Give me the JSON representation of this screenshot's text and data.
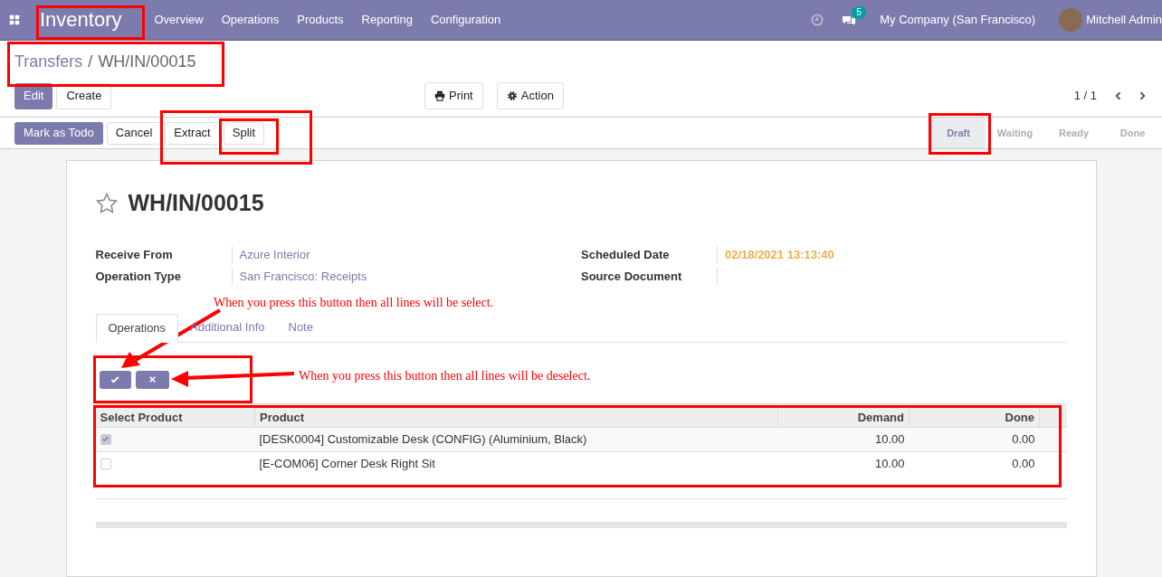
{
  "navbar": {
    "app": "Inventory",
    "menu": [
      "Overview",
      "Operations",
      "Products",
      "Reporting",
      "Configuration"
    ],
    "message_count": "5",
    "company": "My Company (San Francisco)",
    "user": "Mitchell Admin"
  },
  "breadcrumb": {
    "parent": "Transfers",
    "separator": "/",
    "current": "WH/IN/00015"
  },
  "control_buttons": [
    {
      "label": "Edit",
      "kind": "primary"
    },
    {
      "label": "Create",
      "kind": "secondary"
    }
  ],
  "action_buttons": [
    {
      "label": "Print",
      "kind": "print"
    },
    {
      "label": "Action",
      "kind": "gear"
    }
  ],
  "pager": "1 / 1",
  "header_buttons": [
    {
      "label": "Mark as Todo",
      "kind": "primary"
    },
    {
      "label": "Cancel",
      "kind": "secondary"
    },
    {
      "label": "Extract",
      "kind": "secondary"
    },
    {
      "label": "Split",
      "kind": "secondary"
    }
  ],
  "statuses": [
    {
      "label": "Draft",
      "selected": true
    },
    {
      "label": "Waiting",
      "selected": false
    },
    {
      "label": "Ready",
      "selected": false
    },
    {
      "label": "Done",
      "selected": false
    }
  ],
  "form": {
    "title": "WH/IN/00015",
    "starred": false,
    "left_fields": [
      {
        "label": "Receive From",
        "value": "Azure Interior",
        "kind": "link"
      },
      {
        "label": "Operation Type",
        "value": "San Francisco: Receipts",
        "kind": "link"
      }
    ],
    "right_fields": [
      {
        "label": "Scheduled Date",
        "value": "02/18/2021 13:13:40",
        "kind": "warning"
      },
      {
        "label": "Source Document",
        "kind": "empty"
      }
    ],
    "tabs": [
      {
        "label": "Operations",
        "selected": true
      },
      {
        "label": "Additional Info",
        "selected": false
      },
      {
        "label": "Note",
        "selected": false
      }
    ],
    "table": {
      "columns": [
        "Select Product",
        "Product",
        "Demand",
        "Done"
      ],
      "rows": [
        {
          "checked": true,
          "product": "[DESK0004] Customizable Desk (CONFIG) (Aluminium, Black)",
          "demand": "10.00",
          "done": "0.00"
        },
        {
          "checked": false,
          "product": "[E-COM06] Corner Desk Right Sit",
          "demand": "10.00",
          "done": "0.00"
        }
      ]
    }
  },
  "annotations": [
    "When you press this button then all lines will be select.",
    "When you press this button then all lines will be deselect."
  ]
}
